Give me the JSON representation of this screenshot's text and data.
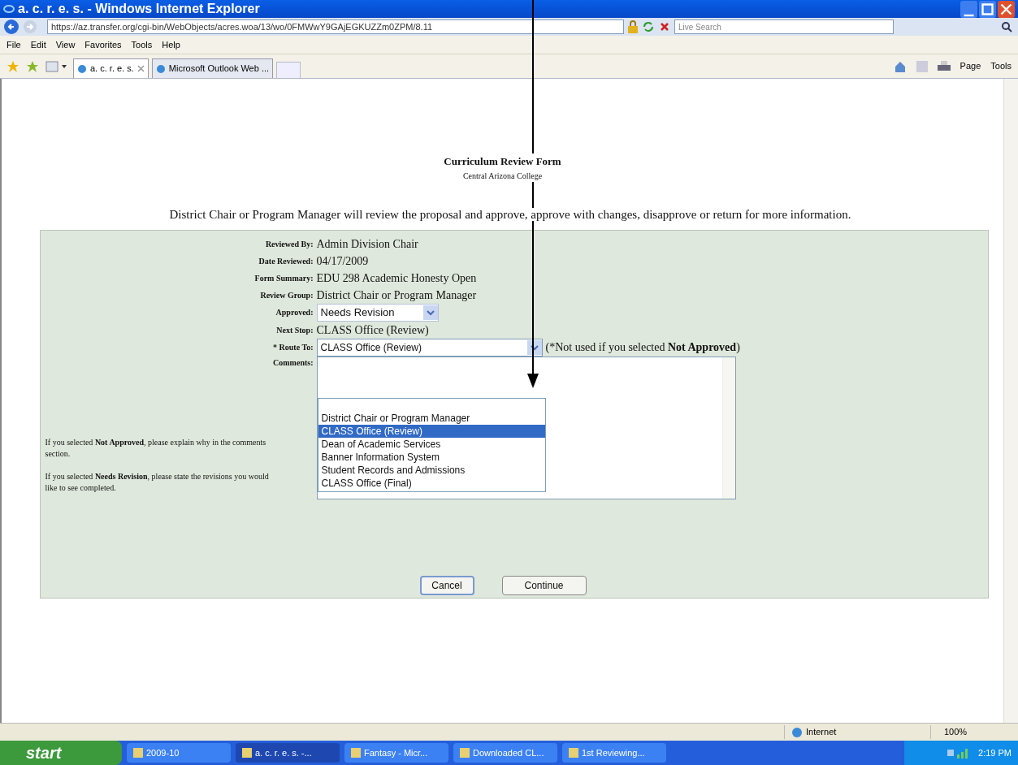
{
  "window": {
    "title": "a. c. r. e. s. - Windows Internet Explorer"
  },
  "address_bar": {
    "url": "https://az.transfer.org/cgi-bin/WebObjects/acres.woa/13/wo/0FMWwY9GAjEGKUZZm0ZPM/8.11",
    "search_placeholder": "Live Search"
  },
  "menu": [
    "File",
    "Edit",
    "View",
    "Favorites",
    "Tools",
    "Help"
  ],
  "tabs": [
    {
      "label": "a. c. r. e. s.",
      "selected": true
    },
    {
      "label": "Microsoft Outlook Web ...",
      "selected": false
    }
  ],
  "command_bar": [
    "Page",
    "Tools"
  ],
  "page": {
    "title": "Curriculum Review Form",
    "subtitle": "Central Arizona College",
    "intro": "District Chair or Program Manager will review the proposal and approve, approve with changes, disapprove or return for more information.",
    "fields": [
      {
        "kind": "text",
        "label": "Reviewed By:",
        "value": "Admin Division Chair"
      },
      {
        "kind": "text",
        "label": "Date Reviewed:",
        "value": "04/17/2009"
      },
      {
        "kind": "text",
        "label": "Form Summary:",
        "value": "EDU 298 Academic Honesty Open"
      },
      {
        "kind": "text",
        "label": "Review Group:",
        "value": "District Chair or Program Manager"
      },
      {
        "kind": "select",
        "label": "Approved:",
        "value": "Needs Revision"
      },
      {
        "kind": "text",
        "label": "Next Stop:",
        "value": "CLASS Office (Review)"
      }
    ],
    "route": {
      "label": "* Route To:",
      "value": "CLASS Office (Review)",
      "note": "(*Not used if you selected **Not Approved**)",
      "options": [
        {
          "label": "District Chair or Program Manager",
          "selected": false
        },
        {
          "label": "CLASS Office (Review)",
          "selected": true
        },
        {
          "label": "Dean of Academic Services",
          "selected": false
        },
        {
          "label": "Banner Information System",
          "selected": false
        },
        {
          "label": "Student Records and Admissions",
          "selected": false
        },
        {
          "label": "CLASS Office (Final)",
          "selected": false
        }
      ]
    },
    "comments_label": "Comments:",
    "notes": [
      "If you selected **Not Approved**, please explain why in the comments section.",
      "If you selected **Needs Revision**, please state the revisions you would like to see completed."
    ],
    "buttons": [
      "Cancel",
      "Continue"
    ]
  },
  "status_bar": {
    "zone": "Internet",
    "zoom": "100%"
  },
  "taskbar": {
    "start": "start",
    "items": [
      {
        "label": "2009-10",
        "selected": false
      },
      {
        "label": "a. c. r. e. s. -...",
        "selected": true
      },
      {
        "label": "Fantasy - Micr...",
        "selected": false
      },
      {
        "label": "Downloaded CL...",
        "selected": false
      },
      {
        "label": "1st Reviewing...",
        "selected": false
      }
    ],
    "clock": "2:19 PM"
  }
}
